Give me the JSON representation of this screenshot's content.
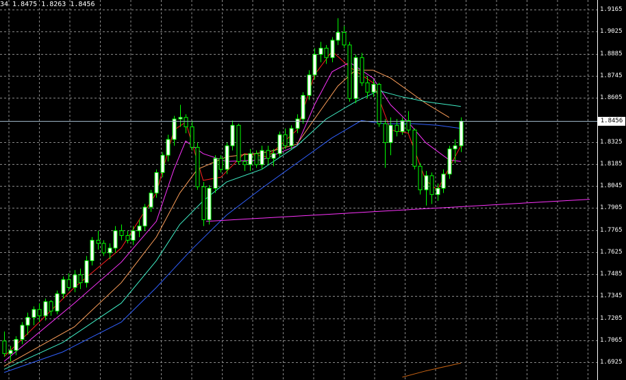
{
  "header": {
    "ohlc_text": "34 1.8475 1.8263 1.8456"
  },
  "current_price": "1.8456",
  "colors": {
    "background": "#000000",
    "grid": "#8a8a8a",
    "bull_body": "#ffffff",
    "bull_border": "#00ff00",
    "bear_body": "#000000",
    "bear_border": "#00ff00",
    "ma_fast": "#ff1f1f",
    "ma_2": "#ff33ff",
    "ma_3": "#ffa05a",
    "ma_4": "#40f0c8",
    "ma_5": "#3060ff",
    "ma_6": "#c86414",
    "trendline": "#ff33ff",
    "bid_line": "#9fb6c8"
  },
  "chart_data": {
    "type": "candlestick",
    "title": "",
    "yaxis_labels": [
      "1.9165",
      "1.9025",
      "1.8885",
      "1.8745",
      "1.8605",
      "1.8325",
      "1.8185",
      "1.8045",
      "1.7905",
      "1.7765",
      "1.7625",
      "1.7485",
      "1.7345",
      "1.7205",
      "1.7065",
      "1.6925"
    ],
    "ylim": [
      1.6875,
      1.921
    ],
    "grid": true,
    "candles": [
      [
        1.706,
        1.712,
        1.696,
        1.698
      ],
      [
        1.698,
        1.703,
        1.693,
        1.7
      ],
      [
        1.7,
        1.709,
        1.697,
        1.707
      ],
      [
        1.707,
        1.718,
        1.704,
        1.716
      ],
      [
        1.716,
        1.724,
        1.71,
        1.721
      ],
      [
        1.721,
        1.728,
        1.716,
        1.726
      ],
      [
        1.726,
        1.73,
        1.718,
        1.722
      ],
      [
        1.722,
        1.733,
        1.719,
        1.731
      ],
      [
        1.731,
        1.732,
        1.722,
        1.725
      ],
      [
        1.725,
        1.738,
        1.723,
        1.736
      ],
      [
        1.736,
        1.747,
        1.733,
        1.745
      ],
      [
        1.745,
        1.749,
        1.738,
        1.74
      ],
      [
        1.74,
        1.751,
        1.737,
        1.748
      ],
      [
        1.748,
        1.752,
        1.739,
        1.743
      ],
      [
        1.743,
        1.76,
        1.74,
        1.757
      ],
      [
        1.757,
        1.772,
        1.754,
        1.77
      ],
      [
        1.77,
        1.776,
        1.764,
        1.768
      ],
      [
        1.768,
        1.77,
        1.76,
        1.762
      ],
      [
        1.762,
        1.768,
        1.758,
        1.765
      ],
      [
        1.765,
        1.779,
        1.762,
        1.776
      ],
      [
        1.776,
        1.78,
        1.77,
        1.773
      ],
      [
        1.773,
        1.776,
        1.768,
        1.77
      ],
      [
        1.77,
        1.779,
        1.767,
        1.776
      ],
      [
        1.776,
        1.783,
        1.772,
        1.779
      ],
      [
        1.779,
        1.793,
        1.776,
        1.791
      ],
      [
        1.791,
        1.802,
        1.788,
        1.8
      ],
      [
        1.8,
        1.815,
        1.797,
        1.813
      ],
      [
        1.813,
        1.826,
        1.81,
        1.824
      ],
      [
        1.824,
        1.837,
        1.82,
        1.834
      ],
      [
        1.834,
        1.849,
        1.83,
        1.847
      ],
      [
        1.847,
        1.856,
        1.842,
        1.848
      ],
      [
        1.848,
        1.85,
        1.838,
        1.842
      ],
      [
        1.842,
        1.846,
        1.827,
        1.829
      ],
      [
        1.829,
        1.832,
        1.802,
        1.804
      ],
      [
        1.804,
        1.807,
        1.779,
        1.783
      ],
      [
        1.783,
        1.805,
        1.78,
        1.803
      ],
      [
        1.803,
        1.824,
        1.8,
        1.822
      ],
      [
        1.822,
        1.824,
        1.813,
        1.815
      ],
      [
        1.815,
        1.832,
        1.812,
        1.83
      ],
      [
        1.83,
        1.846,
        1.827,
        1.843
      ],
      [
        1.843,
        1.844,
        1.818,
        1.82
      ],
      [
        1.82,
        1.825,
        1.814,
        1.818
      ],
      [
        1.818,
        1.828,
        1.814,
        1.825
      ],
      [
        1.825,
        1.827,
        1.816,
        1.818
      ],
      [
        1.818,
        1.83,
        1.815,
        1.827
      ],
      [
        1.827,
        1.83,
        1.818,
        1.822
      ],
      [
        1.822,
        1.828,
        1.817,
        1.825
      ],
      [
        1.825,
        1.839,
        1.823,
        1.837
      ],
      [
        1.837,
        1.841,
        1.828,
        1.83
      ],
      [
        1.83,
        1.843,
        1.828,
        1.841
      ],
      [
        1.841,
        1.85,
        1.838,
        1.847
      ],
      [
        1.847,
        1.864,
        1.844,
        1.862
      ],
      [
        1.862,
        1.878,
        1.859,
        1.875
      ],
      [
        1.875,
        1.892,
        1.872,
        1.888
      ],
      [
        1.888,
        1.896,
        1.883,
        1.892
      ],
      [
        1.892,
        1.894,
        1.882,
        1.886
      ],
      [
        1.886,
        1.899,
        1.883,
        1.897
      ],
      [
        1.897,
        1.911,
        1.894,
        1.902
      ],
      [
        1.902,
        1.906,
        1.892,
        1.894
      ],
      [
        1.894,
        1.896,
        1.858,
        1.86
      ],
      [
        1.86,
        1.888,
        1.857,
        1.886
      ],
      [
        1.886,
        1.889,
        1.868,
        1.87
      ],
      [
        1.87,
        1.874,
        1.86,
        1.864
      ],
      [
        1.864,
        1.872,
        1.861,
        1.869
      ],
      [
        1.869,
        1.87,
        1.842,
        1.844
      ],
      [
        1.844,
        1.847,
        1.816,
        1.832
      ],
      [
        1.832,
        1.848,
        1.824,
        1.843
      ],
      [
        1.843,
        1.847,
        1.836,
        1.839
      ],
      [
        1.839,
        1.848,
        1.837,
        1.846
      ],
      [
        1.846,
        1.852,
        1.838,
        1.84
      ],
      [
        1.84,
        1.841,
        1.815,
        1.817
      ],
      [
        1.817,
        1.819,
        1.799,
        1.802
      ],
      [
        1.802,
        1.814,
        1.792,
        1.811
      ],
      [
        1.811,
        1.813,
        1.793,
        1.799
      ],
      [
        1.799,
        1.806,
        1.795,
        1.803
      ],
      [
        1.803,
        1.815,
        1.8,
        1.812
      ],
      [
        1.812,
        1.83,
        1.809,
        1.828
      ],
      [
        1.828,
        1.834,
        1.819,
        1.83
      ],
      [
        1.83,
        1.848,
        1.826,
        1.8456
      ]
    ],
    "moving_averages": [
      {
        "color_key": "ma_fast",
        "values": [
          [
            0,
            1.696
          ],
          [
            12,
            1.74
          ],
          [
            20,
            1.765
          ],
          [
            26,
            1.8
          ],
          [
            29,
            1.84
          ],
          [
            31,
            1.845
          ],
          [
            34,
            1.808
          ],
          [
            37,
            1.81
          ],
          [
            41,
            1.825
          ],
          [
            45,
            1.823
          ],
          [
            50,
            1.84
          ],
          [
            53,
            1.875
          ],
          [
            56,
            1.89
          ],
          [
            59,
            1.88
          ],
          [
            63,
            1.87
          ],
          [
            66,
            1.84
          ],
          [
            69,
            1.838
          ],
          [
            72,
            1.808
          ],
          [
            74,
            1.802
          ],
          [
            78,
            1.83
          ]
        ]
      },
      {
        "color_key": "ma_2",
        "values": [
          [
            0,
            1.693
          ],
          [
            12,
            1.73
          ],
          [
            20,
            1.756
          ],
          [
            26,
            1.782
          ],
          [
            29,
            1.815
          ],
          [
            31,
            1.833
          ],
          [
            34,
            1.825
          ],
          [
            38,
            1.82
          ],
          [
            44,
            1.821
          ],
          [
            50,
            1.83
          ],
          [
            53,
            1.856
          ],
          [
            56,
            1.877
          ],
          [
            59,
            1.883
          ],
          [
            63,
            1.873
          ],
          [
            66,
            1.856
          ],
          [
            69,
            1.845
          ],
          [
            72,
            1.832
          ],
          [
            76,
            1.821
          ],
          [
            78,
            1.82
          ]
        ]
      },
      {
        "color_key": "ma_3",
        "values": [
          [
            0,
            1.69
          ],
          [
            12,
            1.715
          ],
          [
            20,
            1.743
          ],
          [
            26,
            1.772
          ],
          [
            30,
            1.8
          ],
          [
            33,
            1.815
          ],
          [
            38,
            1.823
          ],
          [
            45,
            1.826
          ],
          [
            50,
            1.831
          ],
          [
            53,
            1.847
          ],
          [
            57,
            1.868
          ],
          [
            60,
            1.878
          ],
          [
            63,
            1.878
          ],
          [
            66,
            1.873
          ],
          [
            69,
            1.865
          ],
          [
            72,
            1.857
          ],
          [
            76,
            1.848
          ]
        ]
      },
      {
        "color_key": "ma_4",
        "values": [
          [
            0,
            1.688
          ],
          [
            10,
            1.705
          ],
          [
            20,
            1.73
          ],
          [
            26,
            1.757
          ],
          [
            30,
            1.78
          ],
          [
            34,
            1.795
          ],
          [
            38,
            1.807
          ],
          [
            44,
            1.815
          ],
          [
            50,
            1.83
          ],
          [
            55,
            1.847
          ],
          [
            60,
            1.858
          ],
          [
            64,
            1.865
          ],
          [
            68,
            1.861
          ],
          [
            72,
            1.858
          ],
          [
            76,
            1.856
          ],
          [
            78,
            1.855
          ]
        ]
      },
      {
        "color_key": "ma_5",
        "values": [
          [
            0,
            1.686
          ],
          [
            10,
            1.699
          ],
          [
            20,
            1.718
          ],
          [
            26,
            1.74
          ],
          [
            32,
            1.764
          ],
          [
            38,
            1.786
          ],
          [
            44,
            1.803
          ],
          [
            50,
            1.819
          ],
          [
            56,
            1.835
          ],
          [
            61,
            1.846
          ],
          [
            65,
            1.844
          ],
          [
            70,
            1.844
          ],
          [
            74,
            1.843
          ],
          [
            78,
            1.841
          ]
        ]
      },
      {
        "color_key": "ma_6",
        "values": [
          [
            68,
            1.683
          ],
          [
            72,
            1.687
          ],
          [
            78,
            1.692
          ]
        ]
      }
    ],
    "trendlines": [
      {
        "color_key": "trendline",
        "from": [
          34.5,
          1.782
        ],
        "to": [
          100,
          1.796
        ]
      }
    ]
  }
}
